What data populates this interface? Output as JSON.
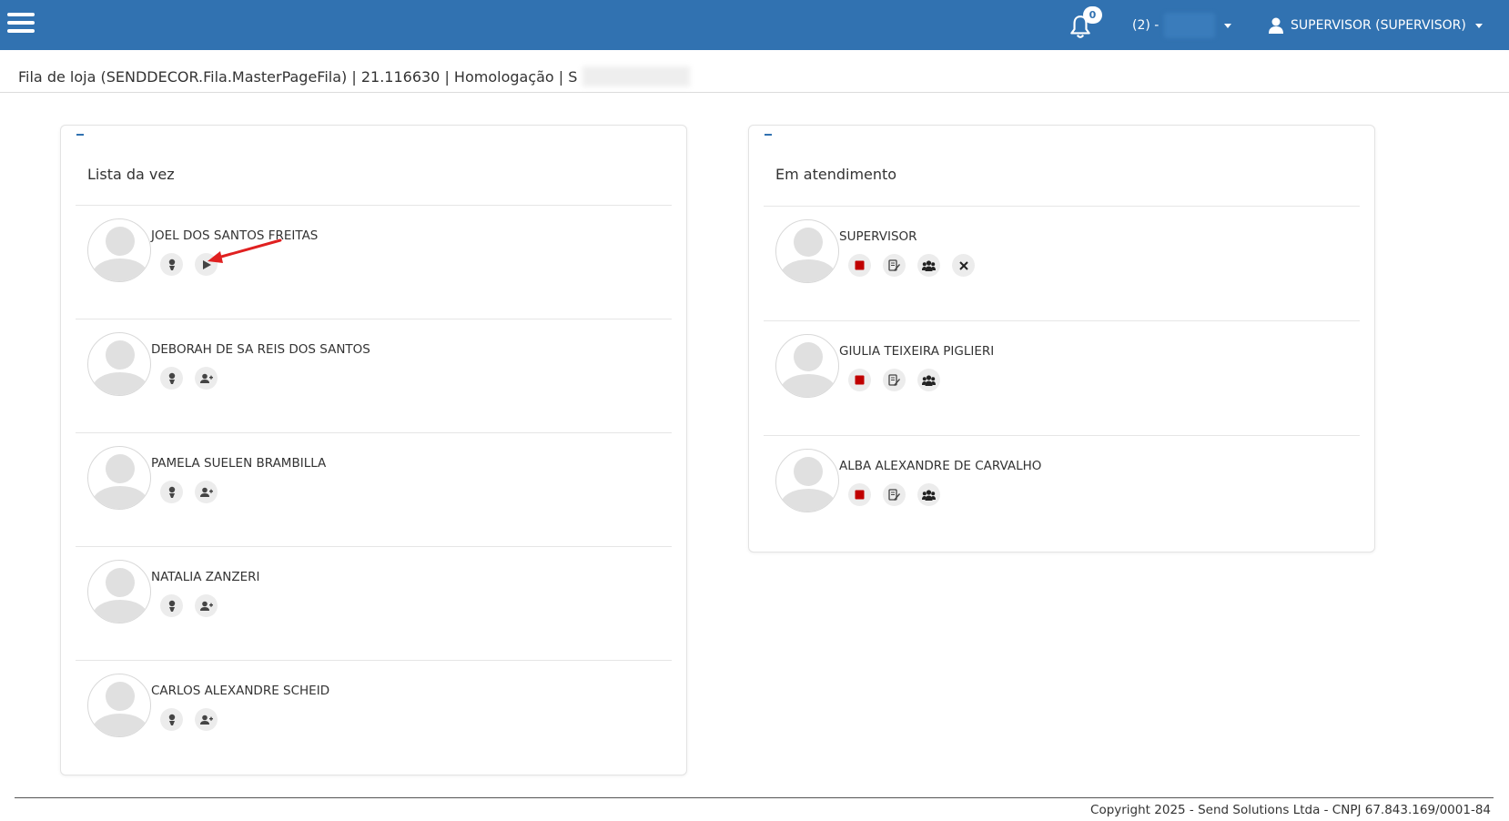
{
  "header": {
    "notifications_count": "0",
    "store_selector_label": "(2) -",
    "user_label": "SUPERVISOR (SUPERVISOR)"
  },
  "page": {
    "title": "Fila de loja (SENDDECOR.Fila.MasterPageFila) | 21.116630 | Homologação | S"
  },
  "queue_panel": {
    "title": "Lista da vez",
    "people": [
      {
        "name": "JOEL DOS SANTOS FREITAS",
        "actions": [
          "person-icon",
          "play-icon"
        ]
      },
      {
        "name": "DEBORAH DE SA REIS DOS SANTOS",
        "actions": [
          "person-icon",
          "add-user-icon"
        ]
      },
      {
        "name": "PAMELA SUELEN BRAMBILLA",
        "actions": [
          "person-icon",
          "add-user-icon"
        ]
      },
      {
        "name": "NATALIA ZANZERI",
        "actions": [
          "person-icon",
          "add-user-icon"
        ]
      },
      {
        "name": "CARLOS ALEXANDRE SCHEID",
        "actions": [
          "person-icon",
          "add-user-icon"
        ]
      }
    ]
  },
  "attending_panel": {
    "title": "Em atendimento",
    "people": [
      {
        "name": "SUPERVISOR",
        "actions": [
          "stop-icon",
          "edit-note-icon",
          "group-icon",
          "close-icon"
        ]
      },
      {
        "name": "GIULIA TEIXEIRA PIGLIERI",
        "actions": [
          "stop-icon",
          "edit-note-icon",
          "group-icon"
        ]
      },
      {
        "name": "ALBA ALEXANDRE DE CARVALHO",
        "actions": [
          "stop-icon",
          "edit-note-icon",
          "group-icon"
        ]
      }
    ]
  },
  "footer": {
    "copyright": "Copyright 2025 - Send Solutions Ltda - CNPJ 67.843.169/0001-84"
  },
  "colors": {
    "topbar": "#3172b1",
    "stop_red": "#c00000",
    "annotation_arrow": "#e02020"
  }
}
